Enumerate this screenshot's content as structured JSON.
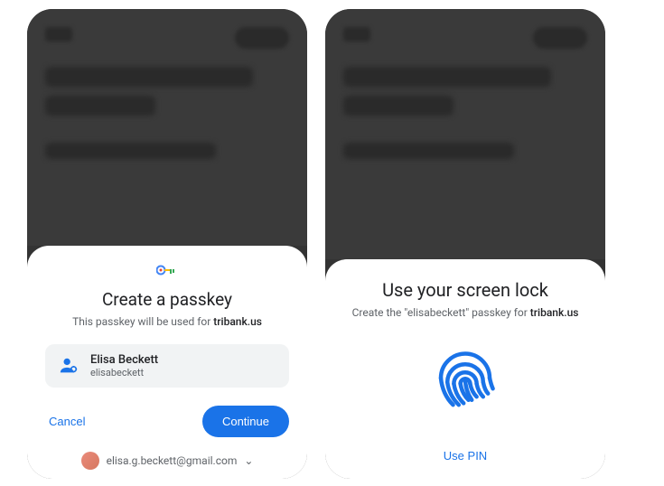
{
  "left": {
    "title": "Create a passkey",
    "subtitle_prefix": "This passkey will be used for ",
    "subtitle_domain": "tribank.us",
    "account_name": "Elisa Beckett",
    "account_username": "elisabeckett",
    "cancel_label": "Cancel",
    "continue_label": "Continue",
    "footer_email": "elisa.g.beckett@gmail.com"
  },
  "right": {
    "title": "Use your screen lock",
    "subtitle_prefix": "Create the \"elisabeckett\" passkey for ",
    "subtitle_domain": "tribank.us",
    "use_pin_label": "Use PIN"
  }
}
